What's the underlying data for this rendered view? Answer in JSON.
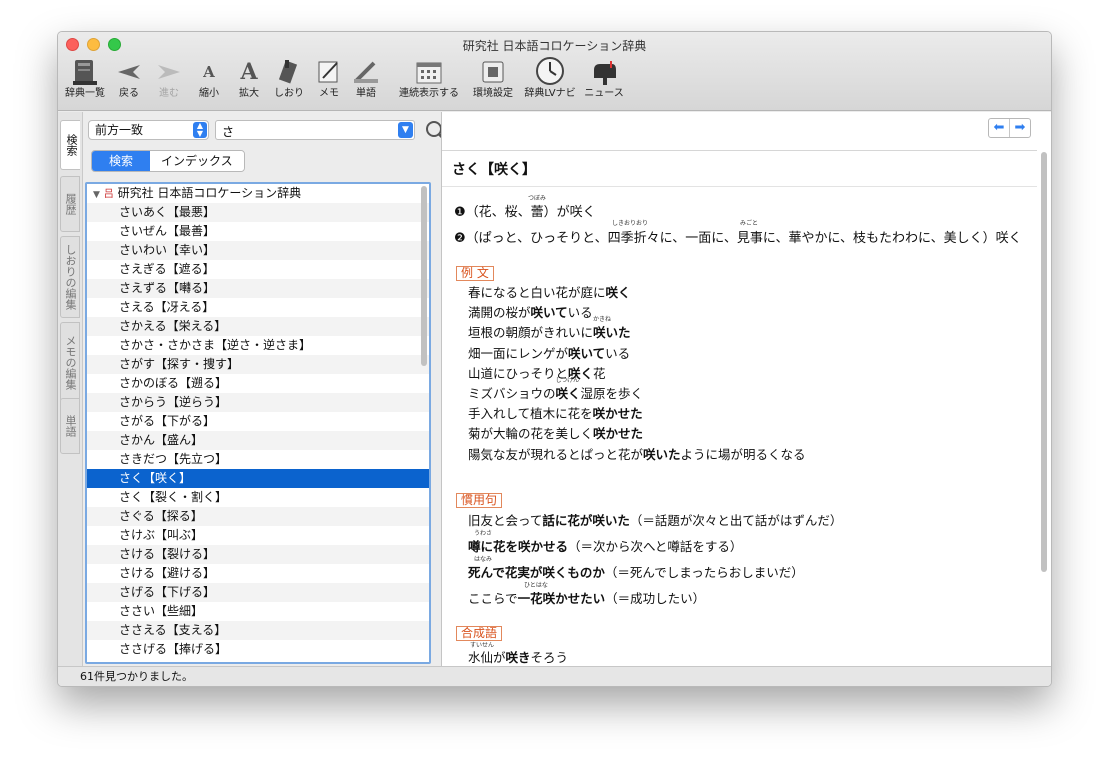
{
  "window": {
    "title": "研究社 日本語コロケーション辞典"
  },
  "toolbar": [
    {
      "name": "dictionary-list",
      "label": "辞典一覧",
      "icon": "books-icon"
    },
    {
      "name": "back",
      "label": "戻る",
      "icon": "back-arrow-icon"
    },
    {
      "name": "forward",
      "label": "進む",
      "icon": "forward-arrow-icon",
      "disabled": true
    },
    {
      "name": "shrink",
      "label": "縮小",
      "icon": "small-a-icon"
    },
    {
      "name": "enlarge",
      "label": "拡大",
      "icon": "large-a-icon"
    },
    {
      "name": "bookmark",
      "label": "しおり",
      "icon": "bookmark-icon"
    },
    {
      "name": "memo",
      "label": "メモ",
      "icon": "memo-icon"
    },
    {
      "name": "word",
      "label": "単語",
      "icon": "pen-icon"
    },
    {
      "name": "continuous",
      "label": "連続表示する",
      "icon": "calendar-icon"
    },
    {
      "name": "preferences",
      "label": "環境設定",
      "icon": "settings-icon"
    },
    {
      "name": "lv-navi",
      "label": "辞典LVナビ",
      "icon": "navigator-icon"
    },
    {
      "name": "news",
      "label": "ニュース",
      "icon": "mailbox-icon"
    }
  ],
  "side_tabs": [
    "検索",
    "履歴",
    "しおりの編集",
    "メモの編集",
    "単語"
  ],
  "search": {
    "mode": "前方一致",
    "query": "さ",
    "seg_search": "検索",
    "seg_index": "インデックス"
  },
  "tree": {
    "root": "研究社 日本語コロケーション辞典",
    "items": [
      "さいあく【最悪】",
      "さいぜん【最善】",
      "さいわい【幸い】",
      "さえぎる【遮る】",
      "さえずる【囀る】",
      "さえる【冴える】",
      "さかえる【栄える】",
      "さかさ・さかさま【逆さ・逆さま】",
      "さがす【探す・捜す】",
      "さかのぼる【遡る】",
      "さからう【逆らう】",
      "さがる【下がる】",
      "さかん【盛ん】",
      "さきだつ【先立つ】",
      "さく【咲く】",
      "さく【裂く・割く】",
      "さぐる【探る】",
      "さけぶ【叫ぶ】",
      "さける【裂ける】",
      "さける【避ける】",
      "さげる【下げる】",
      "ささい【些細】",
      "ささえる【支える】",
      "ささげる【捧げる】"
    ],
    "selected_index": 14
  },
  "entry": {
    "headword": "さく【咲く】",
    "def1": "❶（花、桜、蕾）が咲く",
    "def1_ruby": "つぼみ",
    "def2": "❷（ぱっと、ひっそりと、四季折々に、一面に、見事に、華やかに、枝もたわわに、美しく）咲く",
    "def2_ruby1": "しきおりおり",
    "def2_ruby2": "みごと",
    "sec_examples": "例 文",
    "examples": [
      {
        "pre": "春になると白い花が庭に",
        "bold": "咲く",
        "post": ""
      },
      {
        "pre": "満開の桜が",
        "bold": "咲いて",
        "post": "いる"
      },
      {
        "pre": "垣根の朝顔がきれいに",
        "bold": "咲いた",
        "post": "",
        "ruby": "かきね"
      },
      {
        "pre": "畑一面にレンゲが",
        "bold": "咲いて",
        "post": "いる"
      },
      {
        "pre": "山道にひっそりと",
        "bold": "咲く",
        "post": "花"
      },
      {
        "pre": "ミズバショウの",
        "bold": "咲く",
        "post": "湿原を歩く",
        "ruby": "しつげん"
      },
      {
        "pre": "手入れして植木に花を",
        "bold": "咲かせた",
        "post": ""
      },
      {
        "pre": "菊が大輪の花を美しく",
        "bold": "咲かせた",
        "post": ""
      },
      {
        "pre": "陽気な友が現れるとぱっと花が",
        "bold": "咲いた",
        "post": "ように場が明るくなる"
      }
    ],
    "sec_idioms": "慣用句",
    "idioms": [
      {
        "pre": "旧友と会って",
        "bold": "話に花が咲いた",
        "post": "（＝話題が次々と出て話がはずんだ）"
      },
      {
        "pre": "",
        "bold": "噂に花を咲かせる",
        "post": "（＝次から次へと噂話をする）",
        "ruby": "うわさ"
      },
      {
        "pre": "",
        "bold": "死んで花実が咲くものか",
        "post": "（＝死んでしまったらおしまいだ）",
        "ruby": "はなみ"
      },
      {
        "pre": "ここらで",
        "bold": "一花咲かせたい",
        "post": "（＝成功したい）",
        "ruby": "ひとはな"
      }
    ],
    "sec_compounds": "合成語",
    "compound_first": {
      "pre": "水仙が",
      "bold": "咲き",
      "post": "そろう",
      "ruby": "すいせん"
    }
  },
  "status": "61件見つかりました。",
  "colors": {
    "accent": "#2f7ff0",
    "selection": "#0b63ce",
    "section": "#d9531e"
  }
}
